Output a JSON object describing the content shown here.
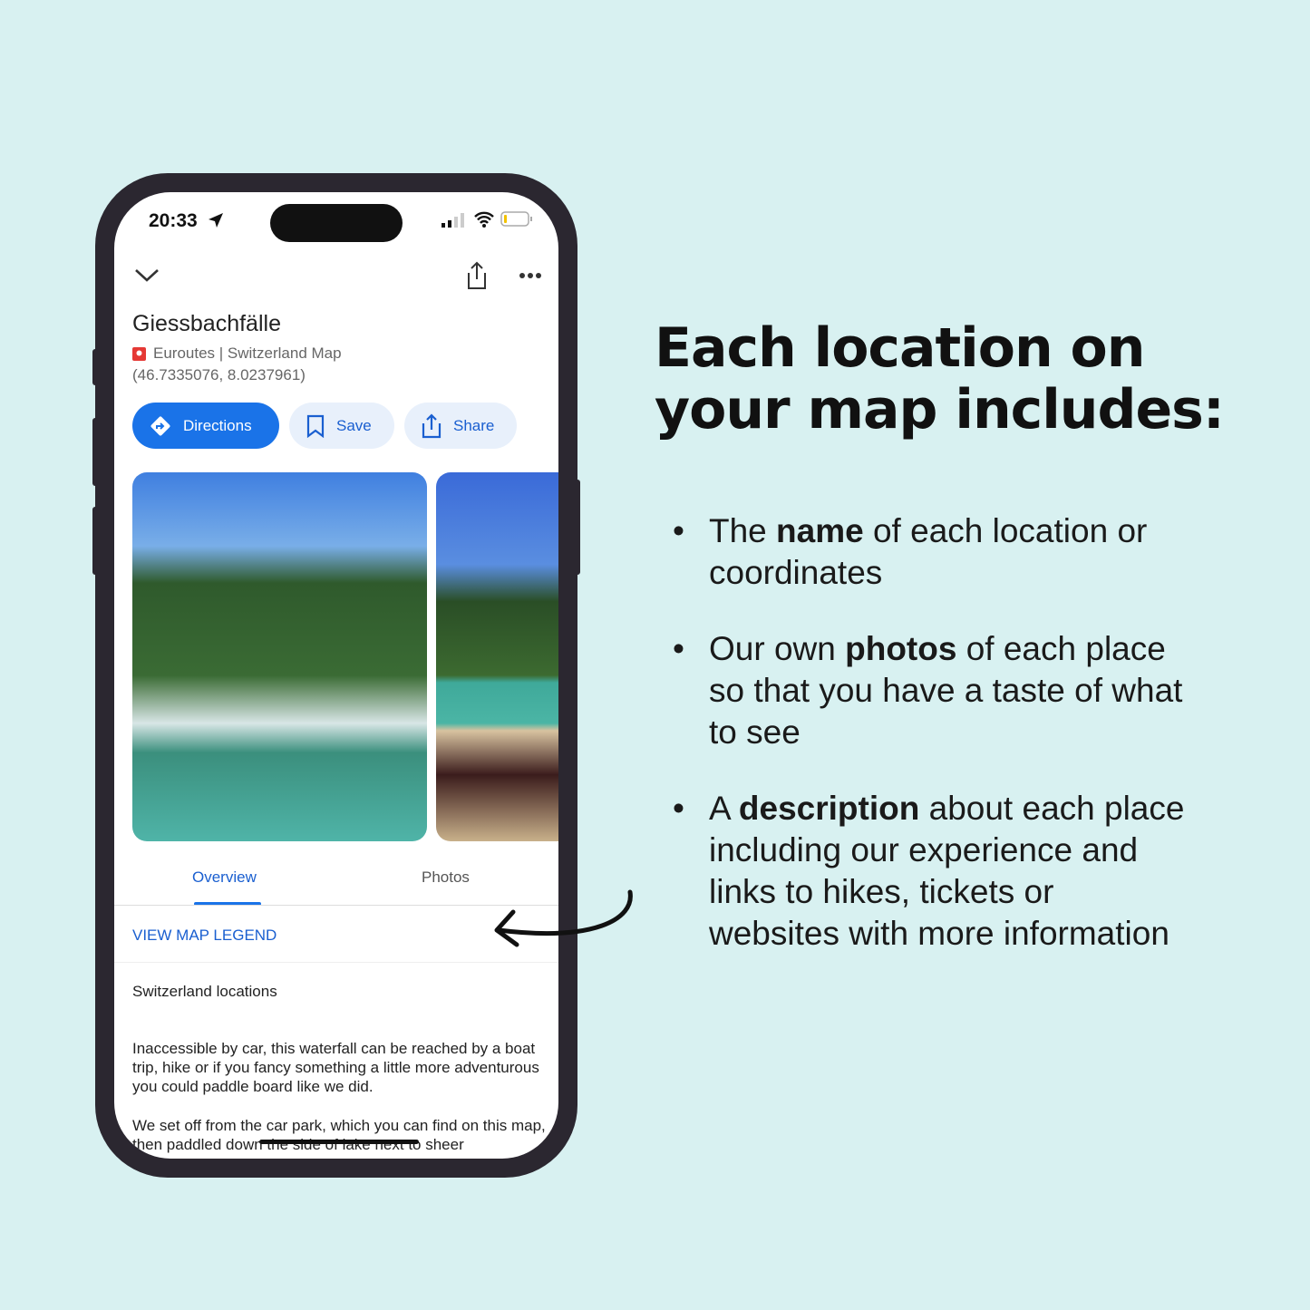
{
  "status_bar": {
    "time": "20:33"
  },
  "place": {
    "name": "Giessbachfälle",
    "source": "Euroutes | Switzerland Map",
    "coordinates": "(46.7335076, 8.0237961)"
  },
  "actions": {
    "directions": "Directions",
    "save": "Save",
    "share": "Share"
  },
  "tabs": [
    {
      "label": "Overview",
      "active": true
    },
    {
      "label": "Photos",
      "active": false
    }
  ],
  "legend_link": "VIEW MAP LEGEND",
  "section_title": "Switzerland locations",
  "description": [
    "Inaccessible by car, this waterfall can be reached by a boat trip, hike or if you fancy something a little more adventurous you could paddle board like we did.",
    "We set off from the car park, which you can find on this map, then paddled down the side of lake next to sheer"
  ],
  "colors": {
    "accent": "#1a73e8",
    "background": "#d8f1f1"
  },
  "promo": {
    "heading_line1": "Each location on",
    "heading_line2": "your map includes:",
    "bullets": [
      {
        "pre": "The ",
        "bold": "name",
        "post": " of each location or coordinates"
      },
      {
        "pre": "Our own ",
        "bold": "photos",
        "post": " of each place so that you have a taste of what to see"
      },
      {
        "pre": "A ",
        "bold": "description",
        "post": " about each place including our experience and links to hikes, tickets or websites with more information"
      }
    ]
  }
}
